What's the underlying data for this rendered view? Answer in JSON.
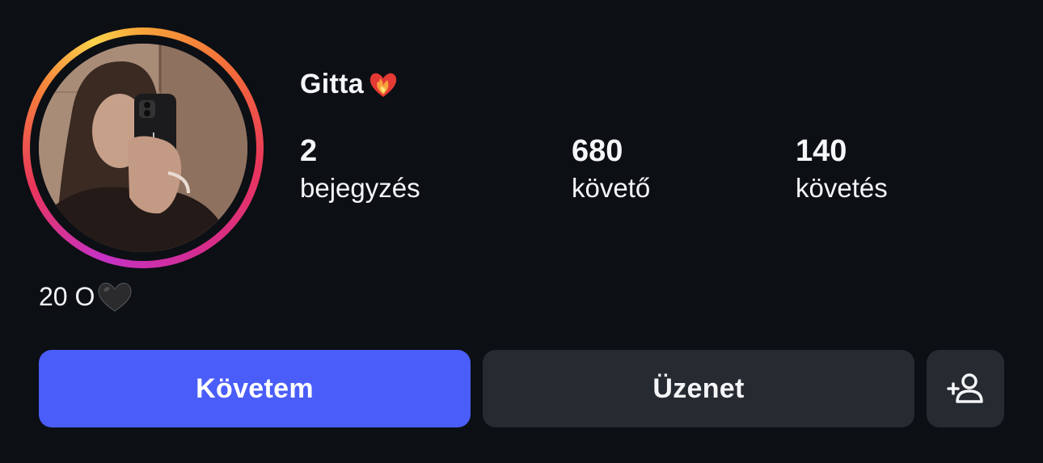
{
  "profile": {
    "username": "Gitta",
    "username_emoji": "heart-on-fire",
    "bio_text": "20 O",
    "bio_emoji": "black-heart",
    "story_ring_colors": [
      "#f7a23a",
      "#e8355c",
      "#c532c6",
      "#fbd24a"
    ]
  },
  "stats": {
    "posts": {
      "count": "2",
      "label": "bejegyzés"
    },
    "followers": {
      "count": "680",
      "label": "követő"
    },
    "following": {
      "count": "140",
      "label": "követés"
    }
  },
  "actions": {
    "follow_label": "Követem",
    "message_label": "Üzenet",
    "add_icon": "person-add-icon"
  },
  "colors": {
    "background": "#0c0f14",
    "primary": "#4a5df9",
    "secondary_button": "#262a31"
  }
}
